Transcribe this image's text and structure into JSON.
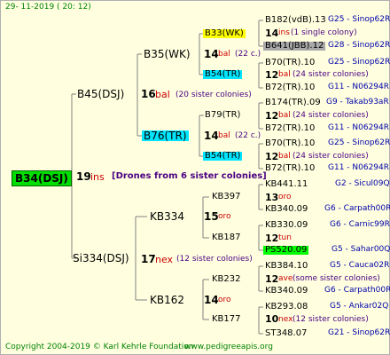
{
  "header": {
    "date": "29- 11-2019 ( 20: 12)"
  },
  "root": {
    "name": "B34(DSJ)",
    "count": "19",
    "nexus": "ins",
    "drones": "[Drones from 6 sister colonies]"
  },
  "gen1": [
    {
      "name": "B45(DSJ)",
      "count": "16",
      "nexus": "bal",
      "sis": "(20 sister colonies)"
    },
    {
      "name": "Si334(DSJ)",
      "count": "17",
      "nexus": "nex",
      "sis": "(12 sister colonies)"
    }
  ],
  "gen2": [
    {
      "name": "B35(WK)",
      "count": "14",
      "nexus": "bal",
      "sis": "(22 c.)"
    },
    {
      "name": "B76(TR)",
      "count": "14",
      "nexus": "bal",
      "sis": "(22 c.)"
    },
    {
      "name": "KB334",
      "count": "15",
      "nexus": "oro"
    },
    {
      "name": "KB162",
      "count": "14",
      "nexus": "oro"
    }
  ],
  "gen3": [
    {
      "name": "B33(WK)",
      "count": "14",
      "nexus": "ins",
      "sis": "(1 single colony)"
    },
    {
      "name": "B54(TR)",
      "count": "12",
      "nexus": "bal",
      "sis": "(24 sister colonies)"
    },
    {
      "name": "B79(TR)",
      "count": "12",
      "nexus": "bal",
      "sis": "(24 sister colonies)"
    },
    {
      "name": "B54(TR)",
      "count": "12",
      "nexus": "bal",
      "sis": "(24 sister colonies)"
    },
    {
      "name": "KB397",
      "count": "13",
      "nexus": "oro"
    },
    {
      "name": "KB187",
      "count": "12",
      "nexus": "tun"
    },
    {
      "name": "KB232",
      "count": "12",
      "nexus": "ave",
      "sis": "(some sister colonies)"
    },
    {
      "name": "KB177",
      "count": "10",
      "nexus": "nex",
      "sis": "(12 sister colonies)"
    }
  ],
  "gen4": [
    {
      "name": "B182(vdB).13",
      "code": "G25 - Sinop62R"
    },
    {
      "name": "B641(JBB).12",
      "code": "G28 - Sinop62R"
    },
    {
      "name": "B70(TR).10",
      "code": "G25 - Sinop62R"
    },
    {
      "name": "B72(TR).10",
      "code": "G11 - N06294R"
    },
    {
      "name": "B174(TR).09",
      "code": "G9 - Takab93aR"
    },
    {
      "name": "B72(TR).10",
      "code": "G11 - N06294R"
    },
    {
      "name": "B70(TR).10",
      "code": "G25 - Sinop62R"
    },
    {
      "name": "B72(TR).10",
      "code": "G11 - N06294R"
    },
    {
      "name": "KB441.11",
      "code": "G2 - Sicul09Q"
    },
    {
      "name": "KB340.09",
      "code": "G6 - Carpath00R"
    },
    {
      "name": "KB330.09",
      "code": "G6 - Carnic99R"
    },
    {
      "name": "PS520.09",
      "code": "G5 - Sahar00Q"
    },
    {
      "name": "KB384.10",
      "code": "G5 - Cauca02R"
    },
    {
      "name": "KB340.09",
      "code": "G6 - Carpath00R"
    },
    {
      "name": "KB293.08",
      "code": "G5 - Ankar02Q"
    },
    {
      "name": "ST348.07",
      "code": "G21 - Sinop62R"
    }
  ],
  "footer": {
    "copyright": "Copyright 2004-2019 © Karl Kehrle Foundation",
    "url": "www.pedigreeapis.org"
  }
}
